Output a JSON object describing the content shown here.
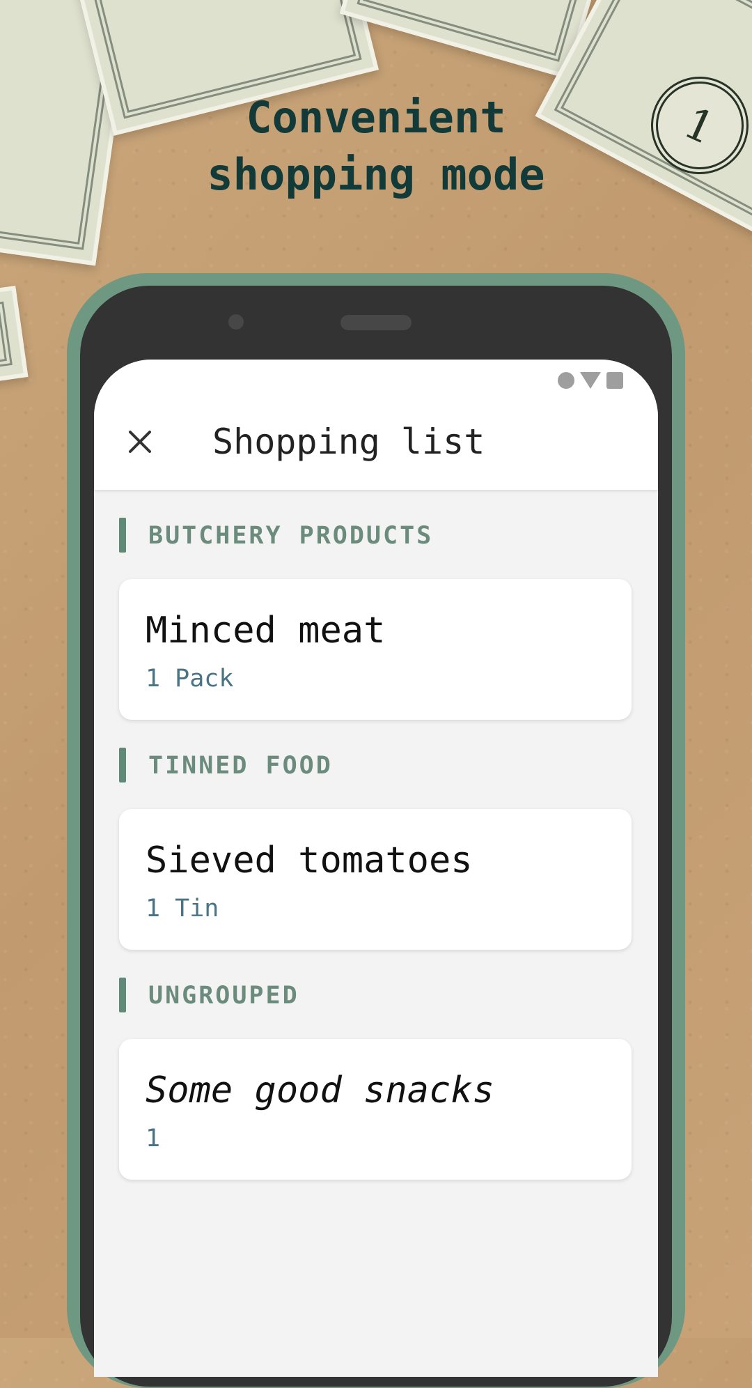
{
  "headline": {
    "line1": "Convenient",
    "line2": "shopping mode"
  },
  "decor": {
    "bill_seal_text": "1"
  },
  "colors": {
    "frame": "#6e9882",
    "section_accent": "#5f8a78",
    "quantity_text": "#4a7486",
    "headline_text": "#123a38"
  },
  "app_bar": {
    "title": "Shopping list",
    "close_icon": "close-icon"
  },
  "status_bar": {
    "icons": [
      "circle",
      "triangle",
      "square"
    ]
  },
  "sections": [
    {
      "label": "BUTCHERY PRODUCTS",
      "items": [
        {
          "name": "Minced meat",
          "quantity": "1 Pack"
        }
      ]
    },
    {
      "label": "TINNED FOOD",
      "items": [
        {
          "name": "Sieved tomatoes",
          "quantity": "1 Tin"
        }
      ]
    },
    {
      "label": "UNGROUPED",
      "items": [
        {
          "name": "Some good snacks",
          "quantity": "1"
        }
      ]
    }
  ]
}
